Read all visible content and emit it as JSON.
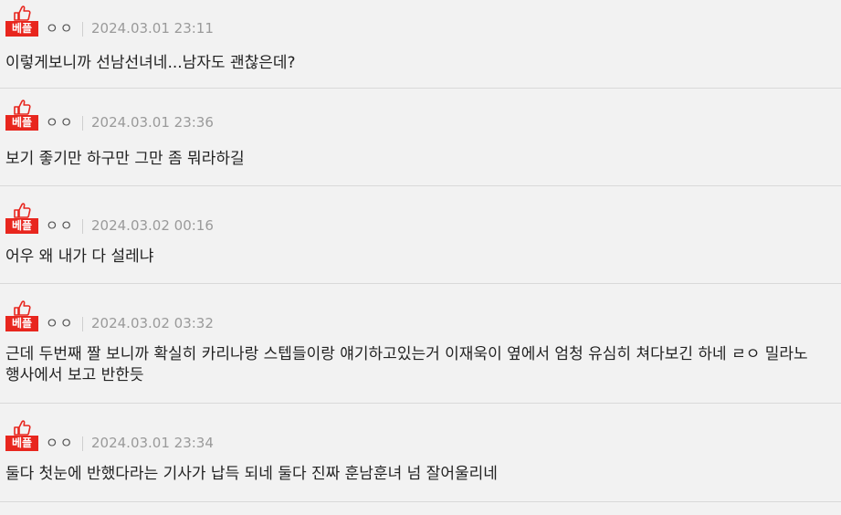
{
  "comments": [
    {
      "badge": "베플",
      "nickname": "ㅇㅇ",
      "date": "2024.03.01 23:11",
      "text": "이렇게보니까 선남선녀네...남자도 괜찮은데?"
    },
    {
      "badge": "베플",
      "nickname": "ㅇㅇ",
      "date": "2024.03.01 23:36",
      "text": "보기 좋기만 하구만 그만 좀 뭐라하길"
    },
    {
      "badge": "베플",
      "nickname": "ㅇㅇ",
      "date": "2024.03.02 00:16",
      "text": "어우 왜 내가 다 설레냐"
    },
    {
      "badge": "베플",
      "nickname": "ㅇㅇ",
      "date": "2024.03.02 03:32",
      "text": "근데 두번째 짤 보니까 확실히 카리나랑 스텝들이랑 얘기하고있는거 이재욱이 옆에서 엄청 유심히 쳐다보긴 하네 ㄹㅇ 밀라노 행사에서 보고 반한듯"
    },
    {
      "badge": "베플",
      "nickname": "ㅇㅇ",
      "date": "2024.03.01 23:34",
      "text": "둘다 첫눈에 반했다라는 기사가 납득 되네 둘다 진짜 훈남훈녀 넘 잘어울리네"
    }
  ],
  "colors": {
    "badge_red": "#e8261e",
    "background": "#f2f2f2",
    "text": "#222222",
    "meta": "#9a9a9a"
  },
  "icons": {
    "badge": "thumbs-up-icon"
  }
}
